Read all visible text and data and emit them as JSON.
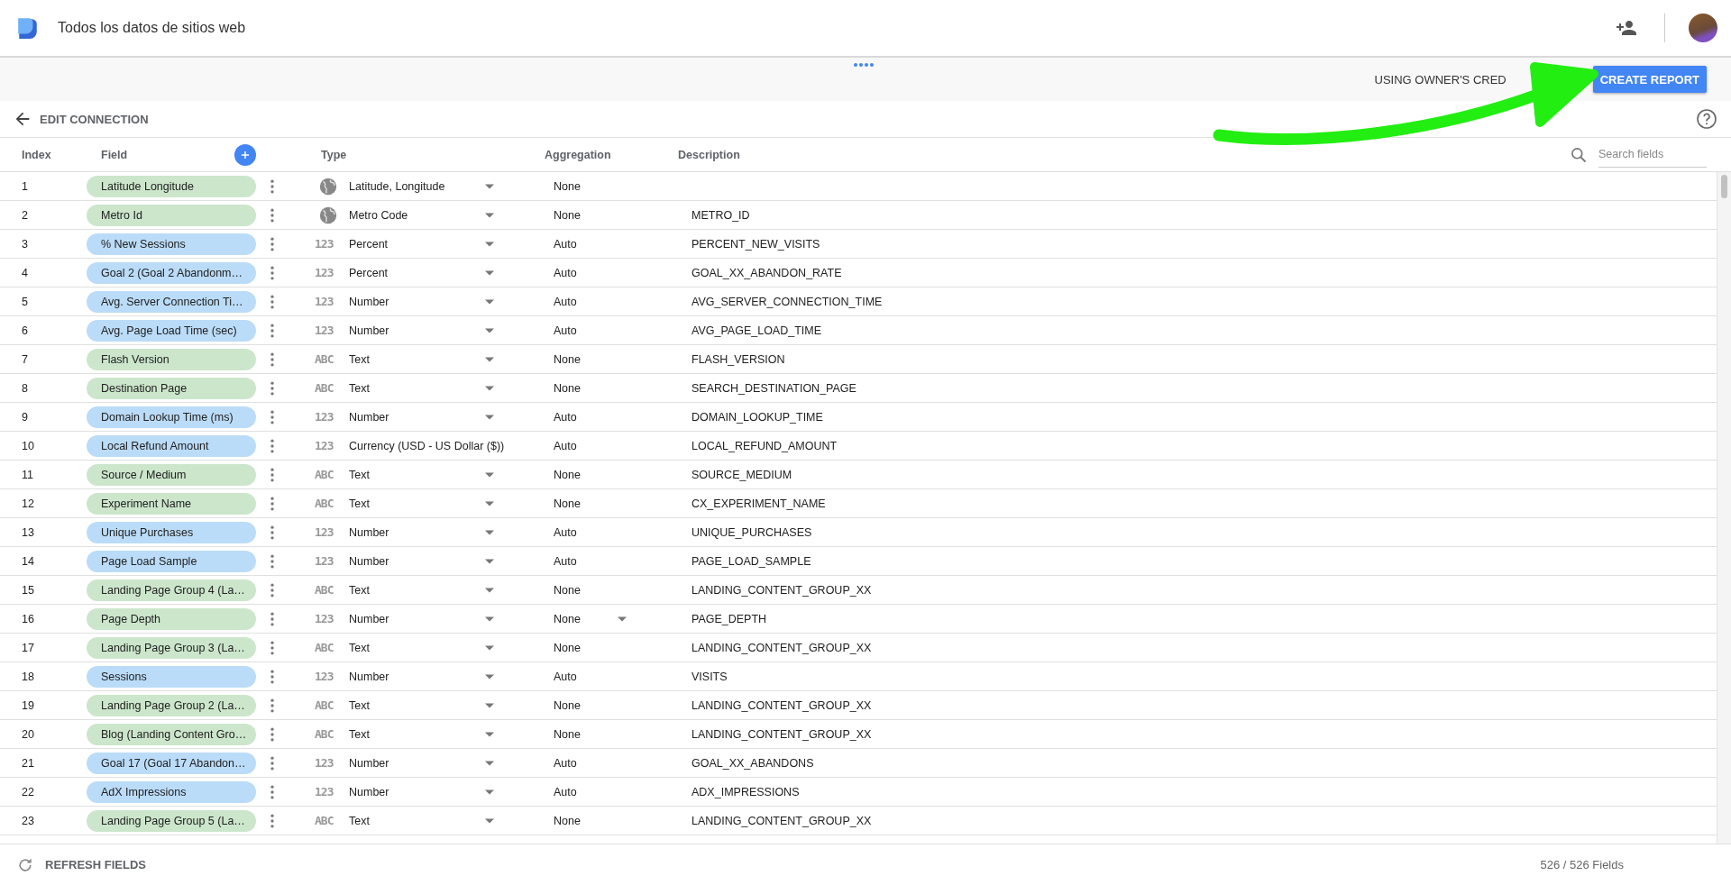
{
  "app": {
    "title": "Todos los datos de sitios web"
  },
  "toolbar": {
    "credentials": "USING OWNER'S CRED",
    "button": "CREATE REPORT"
  },
  "connection": {
    "back_label": "EDIT CONNECTION"
  },
  "table": {
    "columns": [
      "Index",
      "Field",
      "Type",
      "Aggregation",
      "Description"
    ],
    "search": {
      "placeholder": "Search fields"
    },
    "rows": [
      {
        "index": "1",
        "field": "Latitude Longitude",
        "color": "#cce6cc",
        "kind": "geo",
        "type": "Latitude, Longitude",
        "type_menu": true,
        "aggregation": "None",
        "aggregation_menu": false
      },
      {
        "index": "2",
        "field": "Metro Id",
        "color": "#cce6cc",
        "kind": "geo",
        "type": "Metro Code",
        "type_menu": true,
        "aggregation": "None",
        "aggregation_menu": false,
        "description": "METRO_ID"
      },
      {
        "index": "3",
        "field": "% New Sessions",
        "color": "#bbdcf8",
        "kind": "glyph",
        "type_icon": "123",
        "type": "Percent",
        "type_menu": true,
        "aggregation": "Auto",
        "aggregation_menu": false,
        "description": "PERCENT_NEW_VISITS"
      },
      {
        "index": "4",
        "field": "Goal 2 (Goal 2 Abandonm…",
        "color": "#bbdcf8",
        "kind": "glyph",
        "type_icon": "123",
        "type": "Percent",
        "type_menu": true,
        "aggregation": "Auto",
        "aggregation_menu": false,
        "description": "GOAL_XX_ABANDON_RATE"
      },
      {
        "index": "5",
        "field": "Avg. Server Connection Ti…",
        "color": "#bbdcf8",
        "kind": "glyph",
        "type_icon": "123",
        "type": "Number",
        "type_menu": true,
        "aggregation": "Auto",
        "aggregation_menu": false,
        "description": "AVG_SERVER_CONNECTION_TIME"
      },
      {
        "index": "6",
        "field": "Avg. Page Load Time (sec)",
        "color": "#bbdcf8",
        "kind": "glyph",
        "type_icon": "123",
        "type": "Number",
        "type_menu": true,
        "aggregation": "Auto",
        "aggregation_menu": false,
        "description": "AVG_PAGE_LOAD_TIME"
      },
      {
        "index": "7",
        "field": "Flash Version",
        "color": "#cce6cc",
        "kind": "glyph",
        "type_icon": "ABC",
        "type": "Text",
        "type_menu": true,
        "aggregation": "None",
        "aggregation_menu": false,
        "description": "FLASH_VERSION"
      },
      {
        "index": "8",
        "field": "Destination Page",
        "color": "#cce6cc",
        "kind": "glyph",
        "type_icon": "ABC",
        "type": "Text",
        "type_menu": true,
        "aggregation": "None",
        "aggregation_menu": false,
        "description": "SEARCH_DESTINATION_PAGE"
      },
      {
        "index": "9",
        "field": "Domain Lookup Time (ms)",
        "color": "#bbdcf8",
        "kind": "glyph",
        "type_icon": "123",
        "type": "Number",
        "type_menu": true,
        "aggregation": "Auto",
        "aggregation_menu": false,
        "description": "DOMAIN_LOOKUP_TIME"
      },
      {
        "index": "10",
        "field": "Local Refund Amount",
        "color": "#bbdcf8",
        "kind": "glyph",
        "type_icon": "123",
        "type": "Currency (USD - US Dollar ($))",
        "type_menu": false,
        "aggregation": "Auto",
        "aggregation_menu": false,
        "description": "LOCAL_REFUND_AMOUNT"
      },
      {
        "index": "11",
        "field": "Source / Medium",
        "color": "#cce6cc",
        "kind": "glyph",
        "type_icon": "ABC",
        "type": "Text",
        "type_menu": true,
        "aggregation": "None",
        "aggregation_menu": false,
        "description": "SOURCE_MEDIUM"
      },
      {
        "index": "12",
        "field": "Experiment Name",
        "color": "#cce6cc",
        "kind": "glyph",
        "type_icon": "ABC",
        "type": "Text",
        "type_menu": true,
        "aggregation": "None",
        "aggregation_menu": false,
        "description": "CX_EXPERIMENT_NAME"
      },
      {
        "index": "13",
        "field": "Unique Purchases",
        "color": "#bbdcf8",
        "kind": "glyph",
        "type_icon": "123",
        "type": "Number",
        "type_menu": true,
        "aggregation": "Auto",
        "aggregation_menu": false,
        "description": "UNIQUE_PURCHASES"
      },
      {
        "index": "14",
        "field": "Page Load Sample",
        "color": "#bbdcf8",
        "kind": "glyph",
        "type_icon": "123",
        "type": "Number",
        "type_menu": true,
        "aggregation": "Auto",
        "aggregation_menu": false,
        "description": "PAGE_LOAD_SAMPLE"
      },
      {
        "index": "15",
        "field": "Landing Page Group 4 (La…",
        "color": "#cce6cc",
        "kind": "glyph",
        "type_icon": "ABC",
        "type": "Text",
        "type_menu": true,
        "aggregation": "None",
        "aggregation_menu": false,
        "description": "LANDING_CONTENT_GROUP_XX"
      },
      {
        "index": "16",
        "field": "Page Depth",
        "color": "#cce6cc",
        "kind": "glyph",
        "type_icon": "123",
        "type": "Number",
        "type_menu": true,
        "aggregation": "None",
        "aggregation_menu": true,
        "description": "PAGE_DEPTH"
      },
      {
        "index": "17",
        "field": "Landing Page Group 3 (La…",
        "color": "#cce6cc",
        "kind": "glyph",
        "type_icon": "ABC",
        "type": "Text",
        "type_menu": true,
        "aggregation": "None",
        "aggregation_menu": false,
        "description": "LANDING_CONTENT_GROUP_XX"
      },
      {
        "index": "18",
        "field": "Sessions",
        "color": "#bbdcf8",
        "kind": "glyph",
        "type_icon": "123",
        "type": "Number",
        "type_menu": true,
        "aggregation": "Auto",
        "aggregation_menu": false,
        "description": "VISITS"
      },
      {
        "index": "19",
        "field": "Landing Page Group 2 (La…",
        "color": "#cce6cc",
        "kind": "glyph",
        "type_icon": "ABC",
        "type": "Text",
        "type_menu": true,
        "aggregation": "None",
        "aggregation_menu": false,
        "description": "LANDING_CONTENT_GROUP_XX"
      },
      {
        "index": "20",
        "field": "Blog (Landing Content Gro…",
        "color": "#cce6cc",
        "kind": "glyph",
        "type_icon": "ABC",
        "type": "Text",
        "type_menu": true,
        "aggregation": "None",
        "aggregation_menu": false,
        "description": "LANDING_CONTENT_GROUP_XX"
      },
      {
        "index": "21",
        "field": "Goal 17 (Goal 17 Abandon…",
        "color": "#bbdcf8",
        "kind": "glyph",
        "type_icon": "123",
        "type": "Number",
        "type_menu": true,
        "aggregation": "Auto",
        "aggregation_menu": false,
        "description": "GOAL_XX_ABANDONS"
      },
      {
        "index": "22",
        "field": "AdX Impressions",
        "color": "#bbdcf8",
        "kind": "glyph",
        "type_icon": "123",
        "type": "Number",
        "type_menu": true,
        "aggregation": "Auto",
        "aggregation_menu": false,
        "description": "ADX_IMPRESSIONS"
      },
      {
        "index": "23",
        "field": "Landing Page Group 5 (La…",
        "color": "#cce6cc",
        "kind": "glyph",
        "type_icon": "ABC",
        "type": "Text",
        "type_menu": true,
        "aggregation": "None",
        "aggregation_menu": false,
        "description": "LANDING_CONTENT_GROUP_XX"
      }
    ]
  },
  "footer": {
    "refresh": "REFRESH FIELDS",
    "count": "526 / 526 Fields"
  }
}
